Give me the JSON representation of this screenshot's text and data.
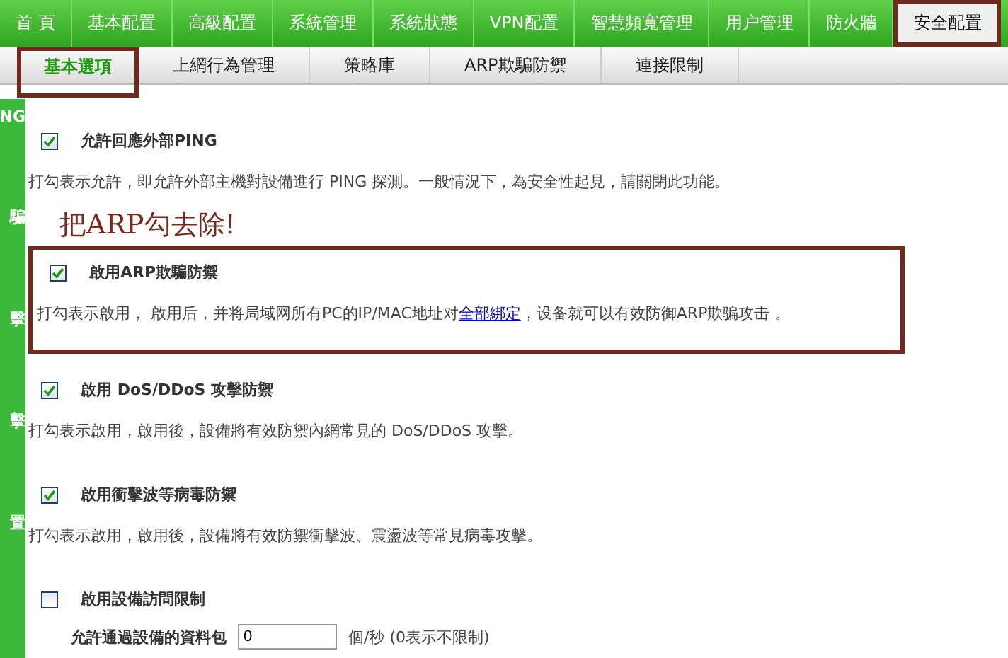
{
  "nav_tabs": [
    {
      "label": "首 頁",
      "selected": false,
      "highlighted": false
    },
    {
      "label": "基本配置",
      "selected": false,
      "highlighted": false
    },
    {
      "label": "高級配置",
      "selected": false,
      "highlighted": false
    },
    {
      "label": "系統管理",
      "selected": false,
      "highlighted": false
    },
    {
      "label": "系統狀態",
      "selected": false,
      "highlighted": false
    },
    {
      "label": "VPN配置",
      "selected": false,
      "highlighted": false
    },
    {
      "label": "智慧頻寬管理",
      "selected": false,
      "highlighted": false
    },
    {
      "label": "用户管理",
      "selected": false,
      "highlighted": false
    },
    {
      "label": "防火牆",
      "selected": false,
      "highlighted": false
    },
    {
      "label": "安全配置",
      "selected": true,
      "highlighted": true
    }
  ],
  "sub_tabs": [
    {
      "label": "基本選項",
      "selected": true,
      "highlighted": true
    },
    {
      "label": "上網行為管理",
      "selected": false,
      "highlighted": false
    },
    {
      "label": "策略庫",
      "selected": false,
      "highlighted": false
    },
    {
      "label": "ARP欺騙防禦",
      "selected": false,
      "highlighted": false
    },
    {
      "label": "連接限制",
      "selected": false,
      "highlighted": false
    }
  ],
  "sidebar": {
    "items": [
      "NG",
      "騙",
      "擊",
      "擊",
      "置"
    ]
  },
  "options": [
    {
      "label": "允許回應外部PING",
      "checked": true,
      "highlighted": false,
      "description": "打勾表示允許，即允許外部主機對設備進行  PING 探測。一般情況下，為安全性起見，請關閉此功能。"
    },
    {
      "label": "啟用ARP欺騙防禦",
      "checked": true,
      "highlighted": true,
      "annotation": "把ARP勾去除!",
      "description": "打勾表示啟用，  啟用后，并将局域网所有PC的IP/MAC地址对",
      "link": "全部綁定",
      "description_after": "，设备就可以有效防御ARP欺骗攻击  。"
    },
    {
      "label": "啟用  DoS/DDoS 攻擊防禦",
      "checked": true,
      "highlighted": false,
      "description": "打勾表示啟用，啟用後，設備將有效防禦內網常見的  DoS/DDoS 攻擊。"
    },
    {
      "label": "啟用衝擊波等病毒防禦",
      "checked": true,
      "highlighted": false,
      "description": "打勾表示啟用，啟用後，設備將有效防禦衝擊波、震盪波等常見病毒攻擊。"
    },
    {
      "label": "啟用設備訪問限制",
      "checked": false,
      "highlighted": false,
      "field": {
        "label": "允許通過設備的資料包",
        "value": "0",
        "unit": "個/秒 (0表示不限制)"
      }
    }
  ]
}
